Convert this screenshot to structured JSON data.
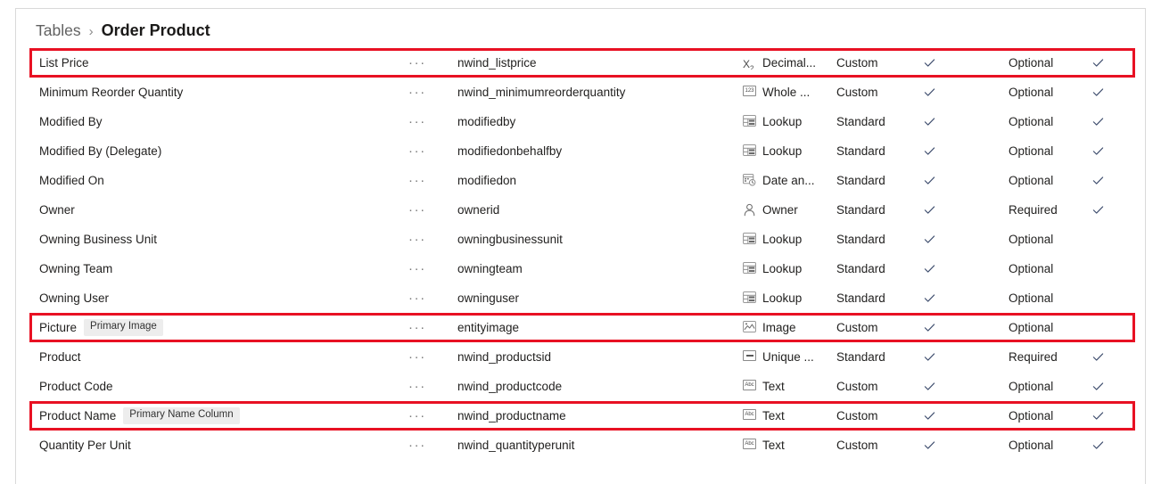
{
  "breadcrumb": {
    "root": "Tables",
    "separator": "›",
    "current": "Order Product"
  },
  "icons": {
    "more": "···",
    "check": "check-icon"
  },
  "colors": {
    "highlight": "#e81123",
    "badge_bg": "#ededed",
    "text": "#201f1e",
    "muted": "#616161",
    "check": "#3b4a6b",
    "panel_border": "#d9d9d9"
  },
  "grid": {
    "rows": [
      {
        "display_name": "List Price",
        "badge": "",
        "more": "···",
        "logical_name": "nwind_listprice",
        "type_icon": "decimal-icon",
        "type": "Decimal...",
        "origin": "Custom",
        "searchable": true,
        "requirement": "Optional",
        "customizable": true,
        "highlighted": true
      },
      {
        "display_name": "Minimum Reorder Quantity",
        "badge": "",
        "more": "···",
        "logical_name": "nwind_minimumreorderquantity",
        "type_icon": "whole-number-icon",
        "type": "Whole ...",
        "origin": "Custom",
        "searchable": true,
        "requirement": "Optional",
        "customizable": true,
        "highlighted": false
      },
      {
        "display_name": "Modified By",
        "badge": "",
        "more": "···",
        "logical_name": "modifiedby",
        "type_icon": "lookup-icon",
        "type": "Lookup",
        "origin": "Standard",
        "searchable": true,
        "requirement": "Optional",
        "customizable": true,
        "highlighted": false
      },
      {
        "display_name": "Modified By (Delegate)",
        "badge": "",
        "more": "···",
        "logical_name": "modifiedonbehalfby",
        "type_icon": "lookup-icon",
        "type": "Lookup",
        "origin": "Standard",
        "searchable": true,
        "requirement": "Optional",
        "customizable": true,
        "highlighted": false
      },
      {
        "display_name": "Modified On",
        "badge": "",
        "more": "···",
        "logical_name": "modifiedon",
        "type_icon": "date-time-icon",
        "type": "Date an...",
        "origin": "Standard",
        "searchable": true,
        "requirement": "Optional",
        "customizable": true,
        "highlighted": false
      },
      {
        "display_name": "Owner",
        "badge": "",
        "more": "···",
        "logical_name": "ownerid",
        "type_icon": "owner-icon",
        "type": "Owner",
        "origin": "Standard",
        "searchable": true,
        "requirement": "Required",
        "customizable": true,
        "highlighted": false
      },
      {
        "display_name": "Owning Business Unit",
        "badge": "",
        "more": "···",
        "logical_name": "owningbusinessunit",
        "type_icon": "lookup-icon",
        "type": "Lookup",
        "origin": "Standard",
        "searchable": true,
        "requirement": "Optional",
        "customizable": false,
        "highlighted": false
      },
      {
        "display_name": "Owning Team",
        "badge": "",
        "more": "···",
        "logical_name": "owningteam",
        "type_icon": "lookup-icon",
        "type": "Lookup",
        "origin": "Standard",
        "searchable": true,
        "requirement": "Optional",
        "customizable": false,
        "highlighted": false
      },
      {
        "display_name": "Owning User",
        "badge": "",
        "more": "···",
        "logical_name": "owninguser",
        "type_icon": "lookup-icon",
        "type": "Lookup",
        "origin": "Standard",
        "searchable": true,
        "requirement": "Optional",
        "customizable": false,
        "highlighted": false
      },
      {
        "display_name": "Picture",
        "badge": "Primary Image",
        "more": "···",
        "logical_name": "entityimage",
        "type_icon": "image-icon",
        "type": "Image",
        "origin": "Custom",
        "searchable": true,
        "requirement": "Optional",
        "customizable": false,
        "highlighted": true
      },
      {
        "display_name": "Product",
        "badge": "",
        "more": "···",
        "logical_name": "nwind_productsid",
        "type_icon": "unique-identifier-icon",
        "type": "Unique ...",
        "origin": "Standard",
        "searchable": true,
        "requirement": "Required",
        "customizable": true,
        "highlighted": false
      },
      {
        "display_name": "Product Code",
        "badge": "",
        "more": "···",
        "logical_name": "nwind_productcode",
        "type_icon": "text-icon",
        "type": "Text",
        "origin": "Custom",
        "searchable": true,
        "requirement": "Optional",
        "customizable": true,
        "highlighted": false
      },
      {
        "display_name": "Product Name",
        "badge": "Primary Name Column",
        "more": "···",
        "logical_name": "nwind_productname",
        "type_icon": "text-icon",
        "type": "Text",
        "origin": "Custom",
        "searchable": true,
        "requirement": "Optional",
        "customizable": true,
        "highlighted": true
      },
      {
        "display_name": "Quantity Per Unit",
        "badge": "",
        "more": "···",
        "logical_name": "nwind_quantityperunit",
        "type_icon": "text-icon",
        "type": "Text",
        "origin": "Custom",
        "searchable": true,
        "requirement": "Optional",
        "customizable": true,
        "highlighted": false
      }
    ]
  }
}
